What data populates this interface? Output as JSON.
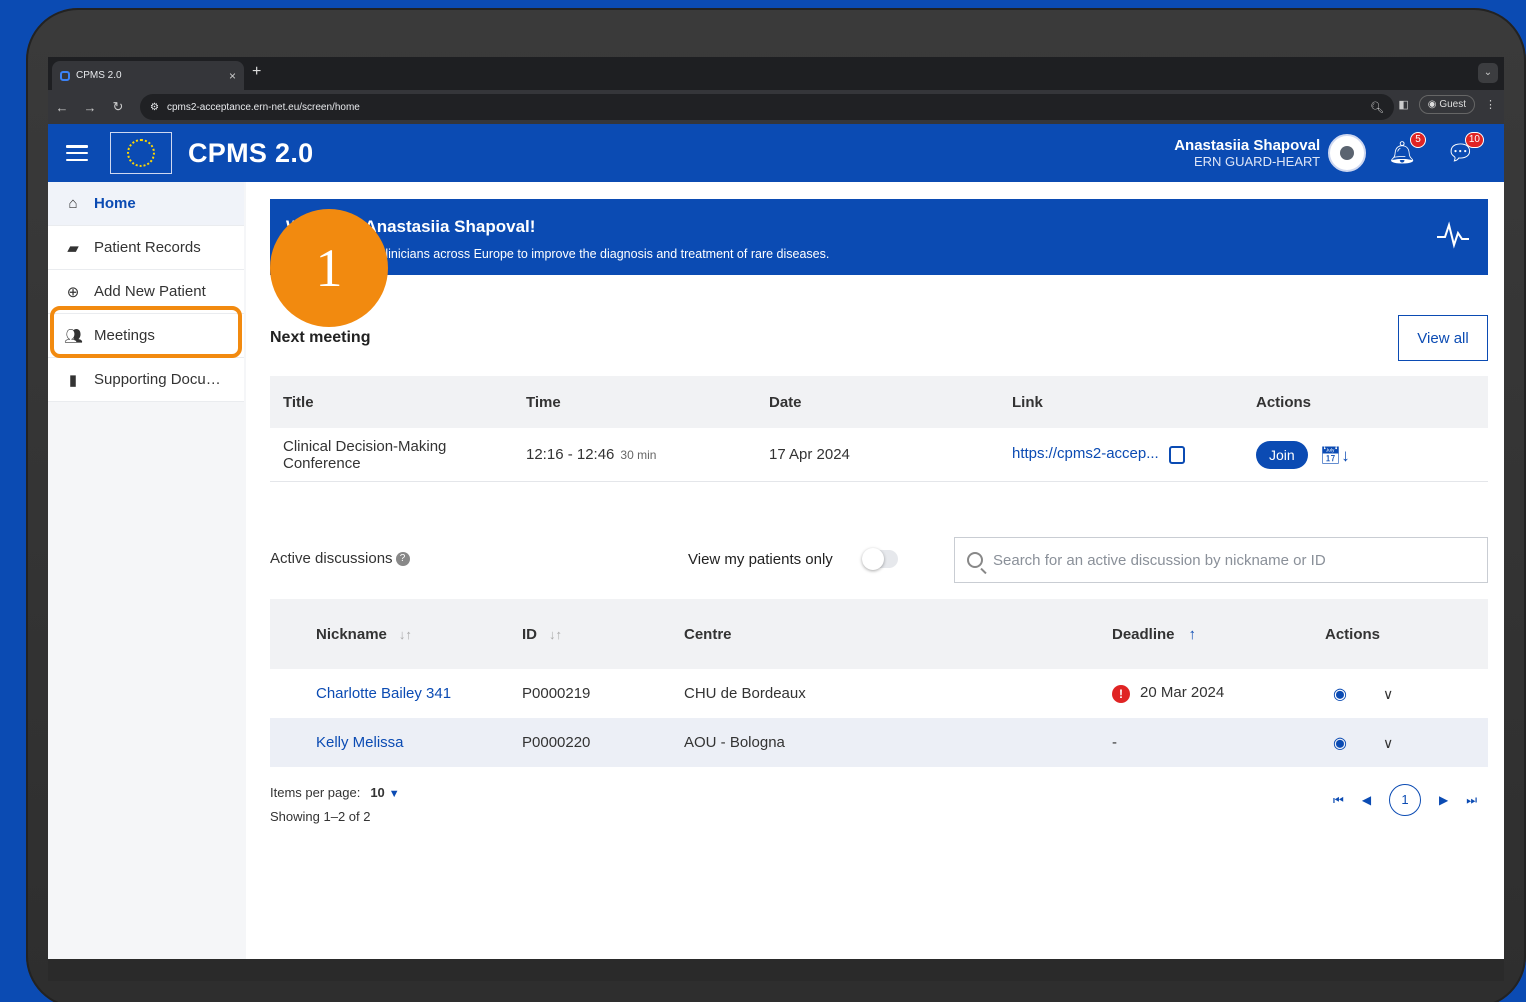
{
  "browser": {
    "tab_title": "CPMS 2.0",
    "tab_close": "×",
    "new_tab": "+",
    "url": "cpms2-acceptance.ern-net.eu/screen/home",
    "profile": "Guest"
  },
  "header": {
    "app_title": "CPMS 2.0",
    "user_name": "Anastasiia Shapoval",
    "user_org": "ERN GUARD-HEART",
    "notifications_count": "5",
    "messages_count": "10"
  },
  "sidebar": {
    "items": [
      {
        "label": "Home",
        "icon": "home-icon"
      },
      {
        "label": "Patient Records",
        "icon": "folder-icon"
      },
      {
        "label": "Add New Patient",
        "icon": "plus-circle-icon"
      },
      {
        "label": "Meetings",
        "icon": "users-icon"
      },
      {
        "label": "Supporting Docu…",
        "icon": "file-icon"
      }
    ]
  },
  "banner": {
    "welcome": "Welcome Anastasiia Shapoval!",
    "subtitle": "Collaborate with clinicians across Europe to improve the diagnosis and treatment of rare diseases."
  },
  "step_marker": "1",
  "next_meeting": {
    "title": "Next meeting",
    "view_all": "View all",
    "columns": [
      "Title",
      "Time",
      "Date",
      "Link",
      "Actions"
    ],
    "row": {
      "title": "Clinical Decision-Making Conference",
      "time": "12:16 - 12:46",
      "duration": "30 min",
      "date": "17 Apr 2024",
      "link": "https://cpms2-accep...",
      "join": "Join"
    }
  },
  "discussions": {
    "label": "Active discussions",
    "help": "?",
    "toggle_label": "View my patients only",
    "toggle_on": false,
    "search_placeholder": "Search for an active discussion by nickname or ID",
    "columns": [
      "Nickname",
      "ID",
      "Centre",
      "Deadline",
      "Actions"
    ],
    "rows": [
      {
        "nickname": "Charlotte Bailey 341",
        "id": "P0000219",
        "centre": "CHU de Bordeaux",
        "deadline": "20 Mar 2024",
        "overdue": true
      },
      {
        "nickname": "Kelly Melissa",
        "id": "P0000220",
        "centre": "AOU - Bologna",
        "deadline": "-",
        "overdue": false
      }
    ],
    "items_per_page_label": "Items per page:",
    "items_per_page": "10",
    "showing": "Showing 1–2 of 2",
    "current_page": "1"
  },
  "colors": {
    "brand": "#0b4bb3",
    "highlight": "#f28a0f",
    "alert": "#e02424"
  }
}
